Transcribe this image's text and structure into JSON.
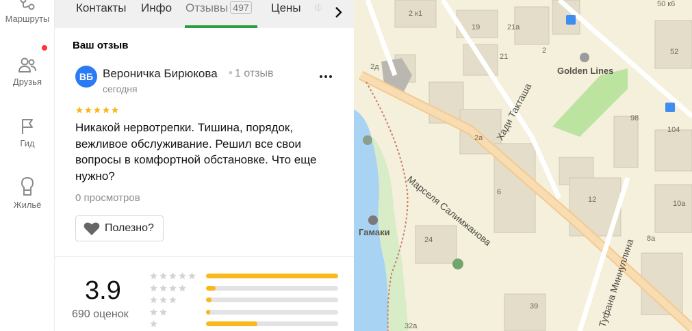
{
  "rail": {
    "items": [
      {
        "label": "Маршруты",
        "icon": "routes-icon"
      },
      {
        "label": "Друзья",
        "icon": "friends-icon"
      },
      {
        "label": "Гид",
        "icon": "guide-flag-icon"
      },
      {
        "label": "Жильё",
        "icon": "housing-icon"
      }
    ]
  },
  "tabs": [
    {
      "label": "Контакты"
    },
    {
      "label": "Инфо"
    },
    {
      "label": "Отзывы",
      "count": "497",
      "active": true
    },
    {
      "label": "Цены"
    },
    {
      "label": "Ф"
    }
  ],
  "review": {
    "section_title": "Ваш отзыв",
    "avatar_initials": "ВБ",
    "author": "Вероничка Бирюкова",
    "separator": "•",
    "author_reviews": "1 отзыв",
    "date": "сегодня",
    "rating": 5,
    "text": "Никакой нервотрепки. Тишина, порядок, вежливое обслуживание. Решил все свои вопросы в комфортной обстановке. Что еще нужно?",
    "views": "0 просмотров",
    "helpful_label": "Полезно?"
  },
  "summary": {
    "rating": "3.9",
    "count_label": "690 оценок",
    "distribution": [
      {
        "stars": 5,
        "fraction": 1.0
      },
      {
        "stars": 4,
        "fraction": 0.07
      },
      {
        "stars": 3,
        "fraction": 0.04
      },
      {
        "stars": 2,
        "fraction": 0.03
      },
      {
        "stars": 1,
        "fraction": 0.39
      }
    ]
  },
  "map": {
    "building_numbers": [
      "2 к1",
      "19",
      "21а",
      "21",
      "2",
      "2д",
      "2а",
      "6",
      "12",
      "98",
      "104",
      "10а",
      "8а",
      "24",
      "39",
      "32а",
      "52",
      "50 к6"
    ],
    "streets": [
      "Хади Такташа",
      "Марселя Салимжанова",
      "Туфана Миннуллина"
    ],
    "pois": [
      "Golden Lines",
      "Гамаки"
    ]
  },
  "colors": {
    "accent_green": "#2a9d3c",
    "avatar_blue": "#2b7bf5",
    "star_gold": "#f9b81c",
    "notif_red": "#ff3333"
  }
}
